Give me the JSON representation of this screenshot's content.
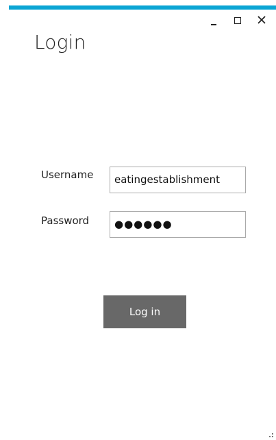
{
  "window": {
    "accent_color": "#0ba5d4",
    "controls": {
      "minimize": "minimize-icon",
      "maximize": "maximize-icon",
      "close": "close-icon"
    }
  },
  "header": {
    "title": "Login"
  },
  "form": {
    "username_label": "Username",
    "username_value": "eatingestablishment",
    "password_label": "Password",
    "password_value": "●●●●●●",
    "submit_label": "Log in",
    "submit_color": "#686868"
  }
}
